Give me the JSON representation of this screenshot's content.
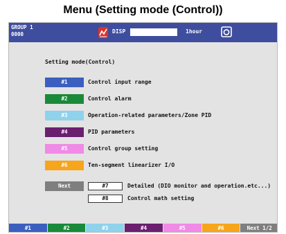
{
  "page_title": "Menu (Setting mode (Control))",
  "statusbar": {
    "group_line1": "GROUP 1",
    "group_line2": "0000",
    "disp_label": "DISP",
    "period_label": "1hour",
    "disp_icon": "disp-icon",
    "camera_icon": "camera-icon"
  },
  "main": {
    "heading": "Setting mode(Control)",
    "items": [
      {
        "key": "#1",
        "label": "Control input range",
        "color": "#3b5fbf"
      },
      {
        "key": "#2",
        "label": "Control alarm",
        "color": "#1a8a3a"
      },
      {
        "key": "#3",
        "label": "Operation-related parameters/Zone PID",
        "color": "#8fd2ec"
      },
      {
        "key": "#4",
        "label": "PID parameters",
        "color": "#6b1f6f"
      },
      {
        "key": "#5",
        "label": "Control group setting",
        "color": "#f08ae6"
      },
      {
        "key": "#6",
        "label": "Ten-segment linearizer I/O",
        "color": "#f7a51c"
      }
    ],
    "next_label": "Next",
    "sub_items": [
      {
        "key": "#7",
        "label": "Detailed (DIO monitor and operation.etc...)"
      },
      {
        "key": "#8",
        "label": "Control math setting"
      }
    ]
  },
  "softkeys": [
    {
      "label": "#1",
      "color": "#3b5fbf"
    },
    {
      "label": "#2",
      "color": "#1a8a3a"
    },
    {
      "label": "#3",
      "color": "#8fd2ec"
    },
    {
      "label": "#4",
      "color": "#6b1f6f"
    },
    {
      "label": "#5",
      "color": "#f08ae6"
    },
    {
      "label": "#6",
      "color": "#f7a51c"
    },
    {
      "label": "Next 1/2",
      "color": "#7f7f7f"
    }
  ]
}
